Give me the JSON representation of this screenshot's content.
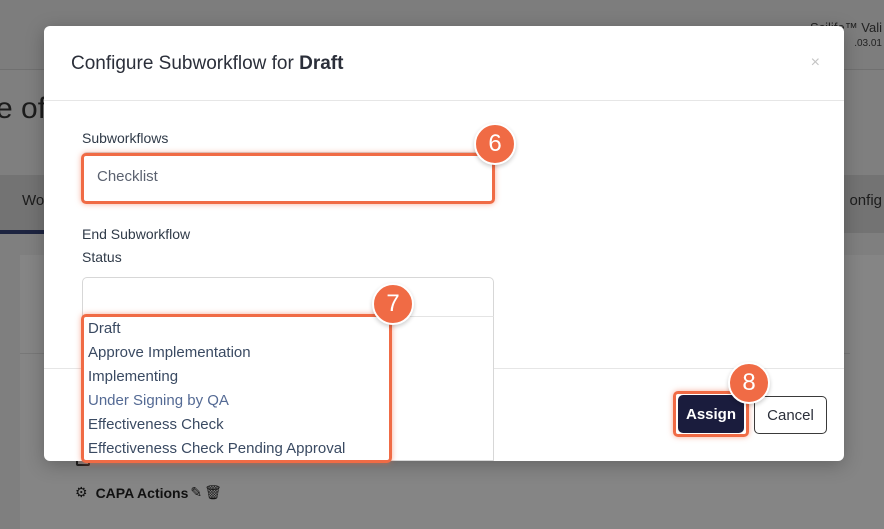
{
  "background": {
    "brand_name": "Scilife™ Vali",
    "brand_version": ".03.01",
    "page_title_fragment": "e of",
    "tab_left_fragment": "Wo",
    "tab_right_fragment": "onfig",
    "capa_label": "CAPA Actions",
    "capa_icon": "workflow-icon",
    "edit_icon": "pencil-icon",
    "delete_icon": "trash-icon"
  },
  "modal": {
    "title_prefix": "Configure Subworkflow for",
    "title_bold": "Draft",
    "close_glyph": "×",
    "subworkflows_label": "Subworkflows",
    "subworkflows_value": "Checklist",
    "end_subworkflow_label": "End Subworkflow",
    "status_label": "Status",
    "status_options": [
      "Draft",
      "Approve Implementation",
      "Implementing",
      "Under Signing by QA",
      "Effectiveness Check",
      "Effectiveness Check Pending Approval"
    ],
    "assign_label": "Assign",
    "cancel_label": "Cancel"
  },
  "annotations": {
    "step_6": "6",
    "step_7": "7",
    "step_8": "8",
    "accent_color": "#f06b45"
  }
}
